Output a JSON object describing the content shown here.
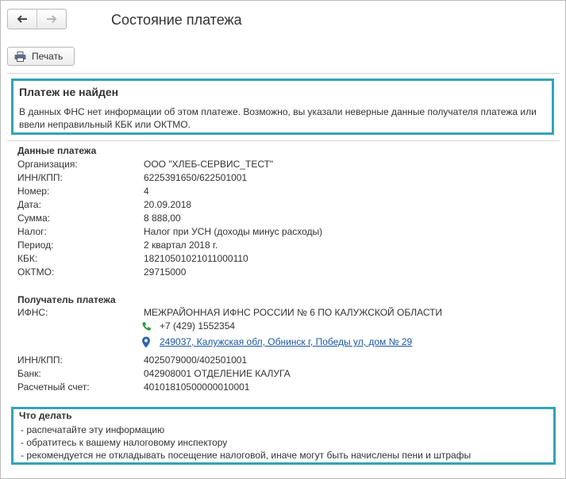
{
  "window": {
    "title": "Состояние платежа"
  },
  "toolbar": {
    "print_label": "Печать"
  },
  "alert": {
    "heading": "Платеж не найден",
    "message": "В данных ФНС нет информации об этом платеже. Возможно, вы указали неверные данные получателя платежа или ввели неправильный КБК или ОКТМО."
  },
  "payment": {
    "heading": "Данные платежа",
    "rows": [
      {
        "label": "Организация:",
        "value": "ООО \"ХЛЕБ-СЕРВИС_ТЕСТ\""
      },
      {
        "label": "ИНН/КПП:",
        "value": "6225391650/622501001"
      },
      {
        "label": "Номер:",
        "value": "4"
      },
      {
        "label": "Дата:",
        "value": "20.09.2018"
      },
      {
        "label": "Сумма:",
        "value": "8 888,00"
      },
      {
        "label": "Налог:",
        "value": "Налог при УСН (доходы минус расходы)"
      },
      {
        "label": "Период:",
        "value": "2 квартал 2018 г."
      },
      {
        "label": "КБК:",
        "value": "18210501021011000110"
      },
      {
        "label": "ОКТМО:",
        "value": "29715000"
      }
    ]
  },
  "recipient": {
    "heading": "Получатель платежа",
    "ifns_label": "ИФНС:",
    "ifns_value": "МЕЖРАЙОННАЯ ИФНС РОССИИ № 6 ПО КАЛУЖСКОЙ ОБЛАСТИ",
    "phone": "+7 (429) 1552354",
    "address": "249037, Калужская обл, Обнинск г, Победы ул, дом № 29",
    "rows": [
      {
        "label": "ИНН/КПП:",
        "value": "4025079000/402501001"
      },
      {
        "label": "Банк:",
        "value": "042908001 ОТДЕЛЕНИЕ КАЛУГА"
      },
      {
        "label": "Расчетный счет:",
        "value": "40101810500000010001"
      }
    ]
  },
  "todo": {
    "heading": "Что делать",
    "items": [
      " - распечатайте эту информацию",
      " - обратитесь к вашему налоговому инспектору",
      " - рекомендуется не откладывать посещение налоговой, иначе могут быть начислены пени и штрафы"
    ]
  },
  "colors": {
    "highlight_border": "#34a3b5",
    "link": "#1b57a6",
    "phone_icon": "#2e9e3c",
    "pin_icon": "#2f63b0"
  },
  "icons": {
    "back": "arrow-left-icon",
    "forward": "arrow-right-icon",
    "print": "printer-icon",
    "phone": "phone-icon",
    "address": "location-pin-icon"
  }
}
